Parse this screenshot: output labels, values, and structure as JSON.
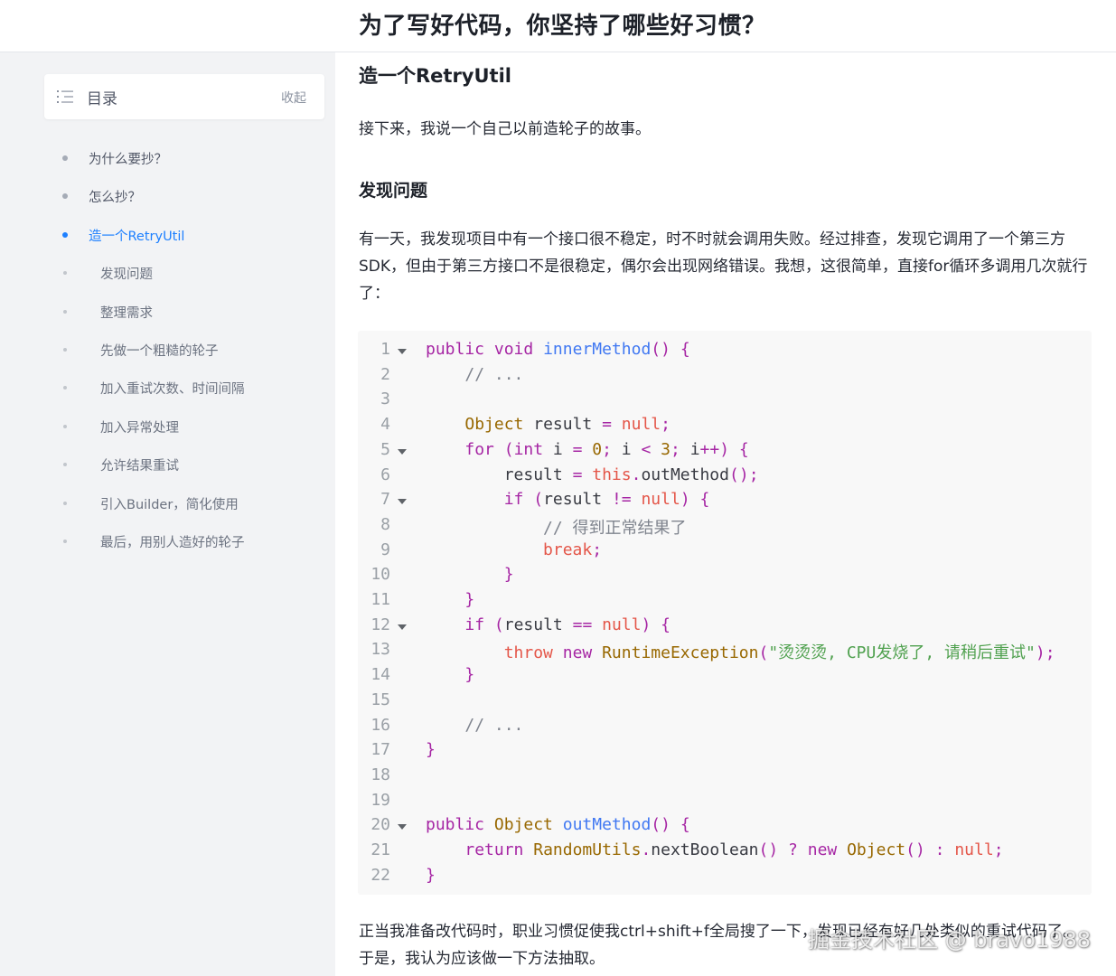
{
  "header": {
    "title": "为了写好代码，你坚持了哪些好习惯？"
  },
  "toc": {
    "title": "目录",
    "collapse_label": "收起",
    "items": [
      {
        "label": "为什么要抄？",
        "level": 1,
        "active": false
      },
      {
        "label": "怎么抄？",
        "level": 1,
        "active": false
      },
      {
        "label": "造一个RetryUtil",
        "level": 1,
        "active": true
      },
      {
        "label": "发现问题",
        "level": 2,
        "active": false
      },
      {
        "label": "整理需求",
        "level": 2,
        "active": false
      },
      {
        "label": "先做一个粗糙的轮子",
        "level": 2,
        "active": false
      },
      {
        "label": "加入重试次数、时间间隔",
        "level": 2,
        "active": false
      },
      {
        "label": "加入异常处理",
        "level": 2,
        "active": false
      },
      {
        "label": "允许结果重试",
        "level": 2,
        "active": false
      },
      {
        "label": "引入Builder，简化使用",
        "level": 2,
        "active": false
      },
      {
        "label": "最后，用别人造好的轮子",
        "level": 2,
        "active": false
      }
    ]
  },
  "article": {
    "heading": "造一个RetryUtil",
    "intro": "接下来，我说一个自己以前造轮子的故事。",
    "subheading": "发现问题",
    "paragraph": "有一天，我发现项目中有一个接口很不稳定，时不时就会调用失败。经过排查，发现它调用了一个第三方SDK，但由于第三方接口不是很稳定，偶尔会出现网络错误。我想，这很简单，直接for循环多调用几次就行了：",
    "after_code": "正当我准备改代码时，职业习惯促使我ctrl+shift+f全局搜了一下，发现已经有好几处类似的重试代码了。于是，我认为应该做一下方法抽取。"
  },
  "code": {
    "language": "java",
    "lines": [
      {
        "n": "1",
        "fold": true,
        "text": "public void innerMethod() {"
      },
      {
        "n": "2",
        "fold": false,
        "text": "    // ..."
      },
      {
        "n": "3",
        "fold": false,
        "text": ""
      },
      {
        "n": "4",
        "fold": false,
        "text": "    Object result = null;"
      },
      {
        "n": "5",
        "fold": true,
        "text": "    for (int i = 0; i < 3; i++) {"
      },
      {
        "n": "6",
        "fold": false,
        "text": "        result = this.outMethod();"
      },
      {
        "n": "7",
        "fold": true,
        "text": "        if (result != null) {"
      },
      {
        "n": "8",
        "fold": false,
        "text": "            // 得到正常结果了"
      },
      {
        "n": "9",
        "fold": false,
        "text": "            break;"
      },
      {
        "n": "10",
        "fold": false,
        "text": "        }"
      },
      {
        "n": "11",
        "fold": false,
        "text": "    }"
      },
      {
        "n": "12",
        "fold": true,
        "text": "    if (result == null) {"
      },
      {
        "n": "13",
        "fold": false,
        "text": "        throw new RuntimeException(\"烫烫烫, CPU发烧了, 请稍后重试\");"
      },
      {
        "n": "14",
        "fold": false,
        "text": "    }"
      },
      {
        "n": "15",
        "fold": false,
        "text": ""
      },
      {
        "n": "16",
        "fold": false,
        "text": "    // ..."
      },
      {
        "n": "17",
        "fold": false,
        "text": "}"
      },
      {
        "n": "18",
        "fold": false,
        "text": ""
      },
      {
        "n": "19",
        "fold": false,
        "text": ""
      },
      {
        "n": "20",
        "fold": true,
        "text": "public Object outMethod() {"
      },
      {
        "n": "21",
        "fold": false,
        "text": "    return RandomUtils.nextBoolean() ? new Object() : null;"
      },
      {
        "n": "22",
        "fold": false,
        "text": "}"
      }
    ]
  },
  "watermark": "掘金技术社区 @ bravo1988",
  "colors": {
    "accent": "#1e80ff",
    "code_bg": "#f8f8f8"
  }
}
